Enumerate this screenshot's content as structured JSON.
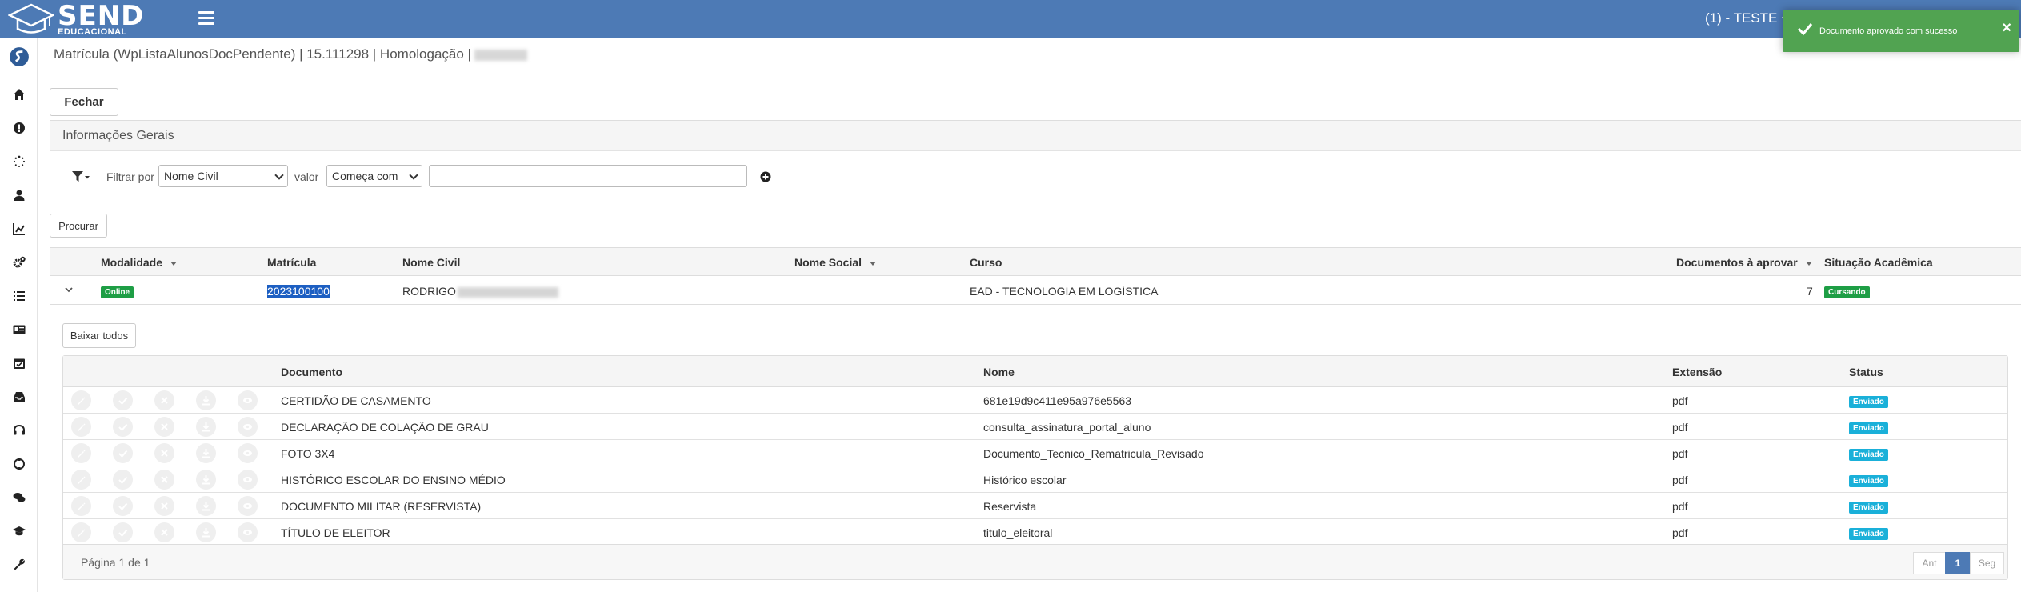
{
  "app": {
    "logo_main": "SEND",
    "logo_sub": "EDUCACIONAL",
    "user_label": "(1) - TESTE"
  },
  "toast": {
    "message": "Documento aprovado com sucesso",
    "close": "×",
    "color": "#51a351"
  },
  "colors": {
    "topbar": "#4d7ab5",
    "badge_green": "#1e9e45",
    "badge_blue": "#1ab0d9"
  },
  "sidebar": {
    "items": [
      "logo-icon",
      "home-icon",
      "alert-icon",
      "spinner-icon",
      "user-icon",
      "chart-icon",
      "cogs-icon",
      "list-icon",
      "id-card-icon",
      "calendar-check-icon",
      "inbox-icon",
      "headset-icon",
      "support-icon",
      "chat-icon",
      "graduation-cap-icon",
      "wrench-icon"
    ]
  },
  "page": {
    "title": "Matrícula (WpListaAlunosDocPendente) | 15.111298 | Homologação |"
  },
  "buttons": {
    "fechar": "Fechar",
    "procurar": "Procurar",
    "baixar_todos": "Baixar todos"
  },
  "panel": {
    "title": "Informações Gerais",
    "filter_label": "Filtrar por",
    "filter_field": "Nome Civil",
    "value_label": "valor",
    "operator": "Começa com",
    "value": ""
  },
  "students": {
    "columns": {
      "modalidade": "Modalidade",
      "matricula": "Matrícula",
      "nome_civil": "Nome Civil",
      "nome_social": "Nome Social",
      "curso": "Curso",
      "documentos": "Documentos à aprovar",
      "situacao": "Situação Acadêmica"
    },
    "row": {
      "modalidade": "Online",
      "matricula": "2023100100",
      "nome_civil": "RODRIGO",
      "nome_social": "",
      "curso": "EAD - TECNOLOGIA EM LOGÍSTICA",
      "documentos": "7",
      "situacao": "Cursando"
    }
  },
  "documents": {
    "columns": {
      "documento": "Documento",
      "nome": "Nome",
      "extensao": "Extensão",
      "status": "Status"
    },
    "rows": [
      {
        "documento": "CERTIDÃO DE CASAMENTO",
        "nome": "681e19d9c411e95a976e5563",
        "extensao": "pdf",
        "status": "Enviado"
      },
      {
        "documento": "DECLARAÇÃO DE COLAÇÃO DE GRAU",
        "nome": "consulta_assinatura_portal_aluno",
        "extensao": "pdf",
        "status": "Enviado"
      },
      {
        "documento": "FOTO 3X4",
        "nome": "Documento_Tecnico_Rematricula_Revisado",
        "extensao": "pdf",
        "status": "Enviado"
      },
      {
        "documento": "HISTÓRICO ESCOLAR DO ENSINO MÉDIO",
        "nome": "Histórico escolar",
        "extensao": "pdf",
        "status": "Enviado"
      },
      {
        "documento": "DOCUMENTO MILITAR (RESERVISTA)",
        "nome": "Reservista",
        "extensao": "pdf",
        "status": "Enviado"
      },
      {
        "documento": "TÍTULO DE ELEITOR",
        "nome": "titulo_eleitoral",
        "extensao": "pdf",
        "status": "Enviado"
      }
    ],
    "actions": [
      "edit-icon",
      "approve-icon",
      "reject-icon",
      "download-icon",
      "view-icon"
    ],
    "pagination": {
      "info": "Página 1 de 1",
      "prev": "Ant",
      "current": "1",
      "next": "Seg"
    }
  }
}
